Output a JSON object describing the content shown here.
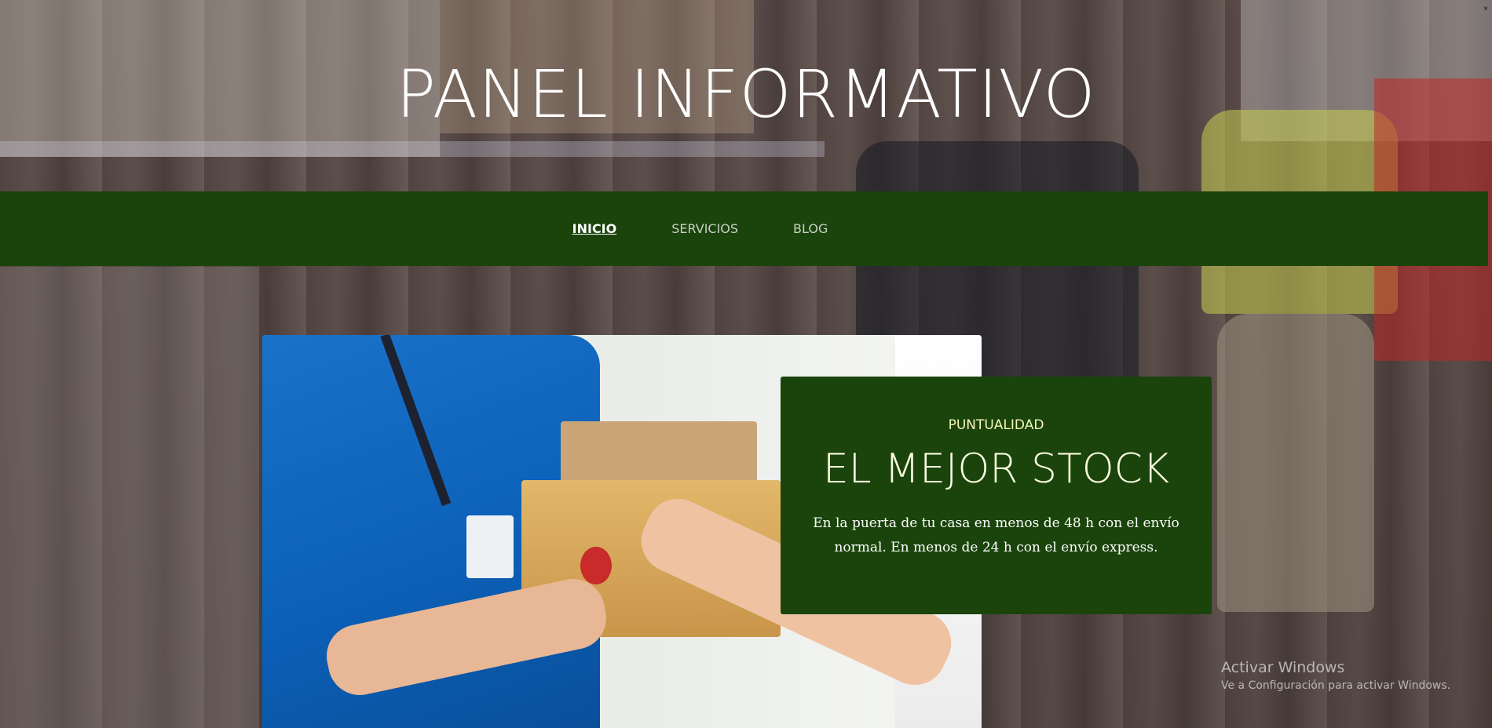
{
  "header": {
    "title": "PANEL INFORMATIVO"
  },
  "nav": {
    "items": [
      {
        "label": "INICIO",
        "active": true
      },
      {
        "label": "SERVICIOS",
        "active": false
      },
      {
        "label": "BLOG",
        "active": false
      }
    ]
  },
  "card": {
    "eyebrow": "PUNTUALIDAD",
    "title": "EL MEJOR STOCK",
    "text": "En la puerta de tu casa en menos de 48 h con el envío normal. En menos de 24 h con el envío express."
  },
  "watermark": {
    "title": "Activar Windows",
    "subtitle": "Ve a Configuración para activar Windows."
  },
  "colors": {
    "nav_background": "#1a440b",
    "card_background": "#1a440b",
    "eyebrow": "#f4f6b8"
  },
  "icons": {
    "hero_image": "delivery-box-image-icon",
    "background": "warehouse-background-icon"
  }
}
